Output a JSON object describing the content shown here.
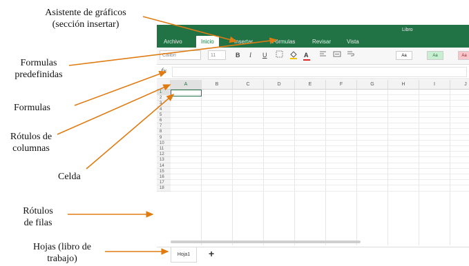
{
  "annotations": {
    "chart_assistant": [
      "Asistente de gráficos",
      "(sección insertar)"
    ],
    "predefined_formulas": [
      "Formulas",
      "predefinidas"
    ],
    "formulas": "Formulas",
    "column_labels": [
      "Rótulos de",
      "columnas"
    ],
    "cell": "Celda",
    "row_labels": [
      "Rótulos",
      "de filas"
    ],
    "sheets": [
      "Hojas (libro de",
      "trabajo)"
    ]
  },
  "app": {
    "title": "Libro",
    "tabs": [
      "Archivo",
      "Inicio",
      "Insertar",
      "Fórmulas",
      "Revisar",
      "Vista"
    ],
    "active_tab": "Inicio",
    "font_name": "Calibri",
    "font_size": "11",
    "bold": "B",
    "italic": "I",
    "underline": "U",
    "font_color": "A",
    "styles": [
      "Aa",
      "Aa",
      "Aa"
    ],
    "fx": "fx",
    "columns": [
      "A",
      "B",
      "C",
      "D",
      "E",
      "F",
      "G",
      "H",
      "I",
      "J"
    ],
    "rows": [
      "1",
      "2",
      "3",
      "4",
      "5",
      "6",
      "7",
      "8",
      "9",
      "10",
      "11",
      "12",
      "13",
      "14",
      "15",
      "16",
      "17",
      "18"
    ],
    "sheet_tab": "Hoja1",
    "add_sheet": "+",
    "colors": {
      "ribbon": "#217346",
      "selection": "#217346",
      "arrows": "#e07b12"
    }
  }
}
